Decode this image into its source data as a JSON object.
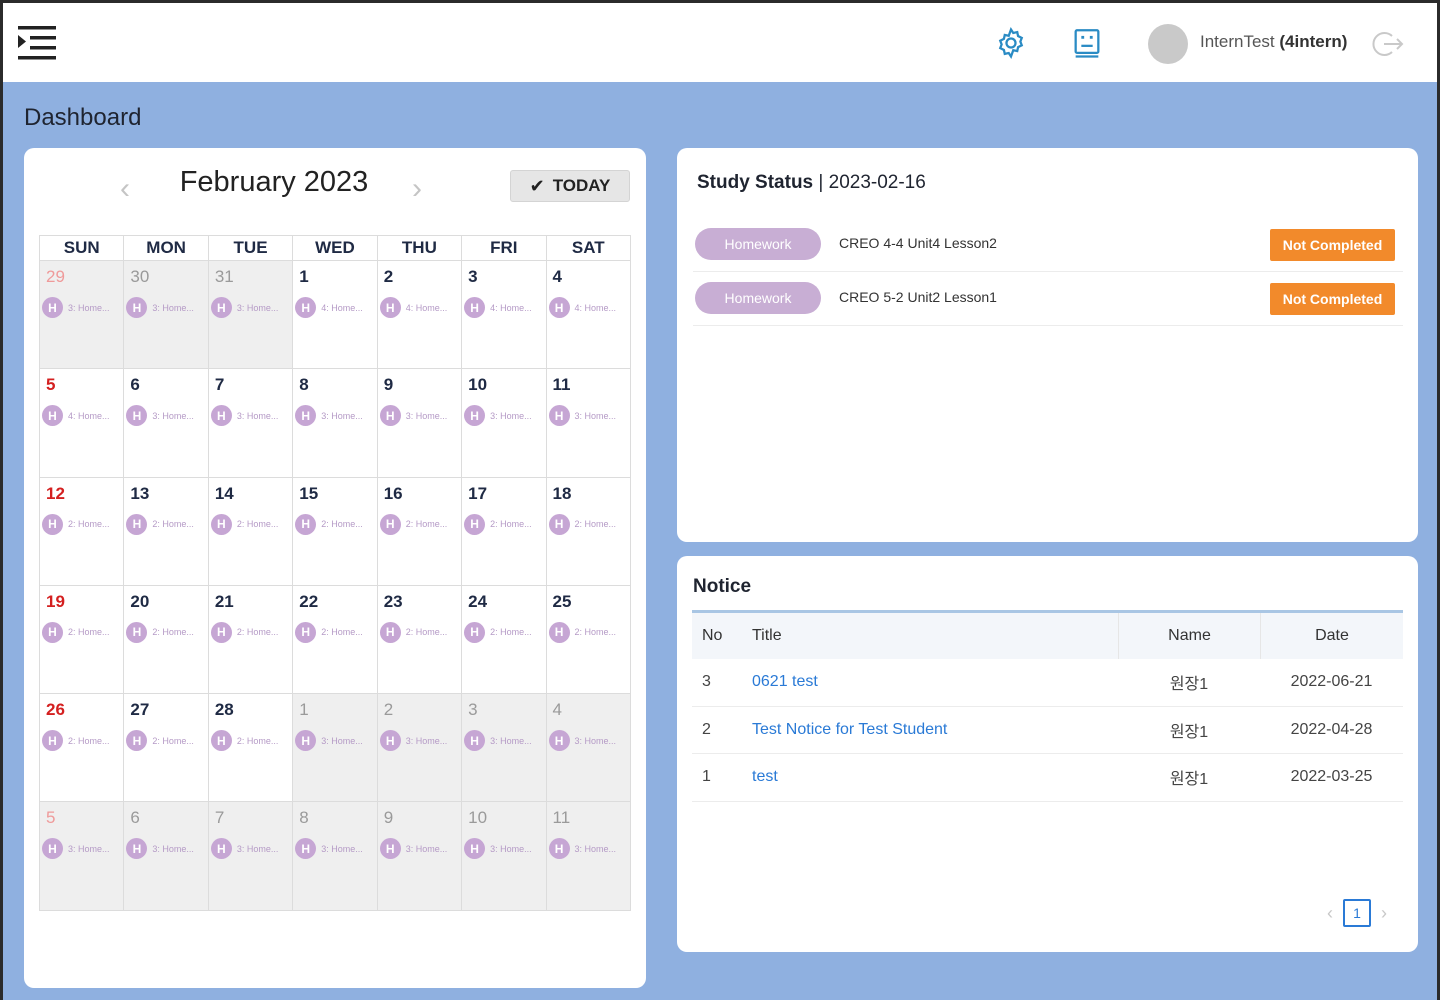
{
  "header": {
    "menu_icon": "indent-menu-icon",
    "settings_icon": "gear-icon",
    "profile_icon": "id-card-icon",
    "user_name": "InternTest",
    "user_id": "(4intern)",
    "logout_icon": "logout-icon"
  },
  "page_title": "Dashboard",
  "calendar": {
    "month_label": "February 2023",
    "today_label": "TODAY",
    "weekdays": [
      "SUN",
      "MON",
      "TUE",
      "WED",
      "THU",
      "FRI",
      "SAT"
    ],
    "weeks": [
      [
        {
          "day": "29",
          "other": true,
          "ev": "3: Home..."
        },
        {
          "day": "30",
          "other": true,
          "ev": "3: Home..."
        },
        {
          "day": "31",
          "other": true,
          "ev": "3: Home..."
        },
        {
          "day": "1",
          "other": false,
          "ev": "4: Home..."
        },
        {
          "day": "2",
          "other": false,
          "ev": "4: Home..."
        },
        {
          "day": "3",
          "other": false,
          "ev": "4: Home..."
        },
        {
          "day": "4",
          "other": false,
          "ev": "4: Home..."
        }
      ],
      [
        {
          "day": "5",
          "other": false,
          "ev": "4: Home..."
        },
        {
          "day": "6",
          "other": false,
          "ev": "3: Home..."
        },
        {
          "day": "7",
          "other": false,
          "ev": "3: Home..."
        },
        {
          "day": "8",
          "other": false,
          "ev": "3: Home..."
        },
        {
          "day": "9",
          "other": false,
          "ev": "3: Home..."
        },
        {
          "day": "10",
          "other": false,
          "ev": "3: Home..."
        },
        {
          "day": "11",
          "other": false,
          "ev": "3: Home..."
        }
      ],
      [
        {
          "day": "12",
          "other": false,
          "ev": "2: Home..."
        },
        {
          "day": "13",
          "other": false,
          "ev": "2: Home..."
        },
        {
          "day": "14",
          "other": false,
          "ev": "2: Home..."
        },
        {
          "day": "15",
          "other": false,
          "ev": "2: Home..."
        },
        {
          "day": "16",
          "other": false,
          "ev": "2: Home..."
        },
        {
          "day": "17",
          "other": false,
          "ev": "2: Home..."
        },
        {
          "day": "18",
          "other": false,
          "ev": "2: Home..."
        }
      ],
      [
        {
          "day": "19",
          "other": false,
          "ev": "2: Home..."
        },
        {
          "day": "20",
          "other": false,
          "ev": "2: Home..."
        },
        {
          "day": "21",
          "other": false,
          "ev": "2: Home..."
        },
        {
          "day": "22",
          "other": false,
          "ev": "2: Home..."
        },
        {
          "day": "23",
          "other": false,
          "ev": "2: Home..."
        },
        {
          "day": "24",
          "other": false,
          "ev": "2: Home..."
        },
        {
          "day": "25",
          "other": false,
          "ev": "2: Home..."
        }
      ],
      [
        {
          "day": "26",
          "other": false,
          "ev": "2: Home..."
        },
        {
          "day": "27",
          "other": false,
          "ev": "2: Home..."
        },
        {
          "day": "28",
          "other": false,
          "ev": "2: Home..."
        },
        {
          "day": "1",
          "other": true,
          "ev": "3: Home..."
        },
        {
          "day": "2",
          "other": true,
          "ev": "3: Home..."
        },
        {
          "day": "3",
          "other": true,
          "ev": "3: Home..."
        },
        {
          "day": "4",
          "other": true,
          "ev": "3: Home..."
        }
      ],
      [
        {
          "day": "5",
          "other": true,
          "ev": "3: Home..."
        },
        {
          "day": "6",
          "other": true,
          "ev": "3: Home..."
        },
        {
          "day": "7",
          "other": true,
          "ev": "3: Home..."
        },
        {
          "day": "8",
          "other": true,
          "ev": "3: Home..."
        },
        {
          "day": "9",
          "other": true,
          "ev": "3: Home..."
        },
        {
          "day": "10",
          "other": true,
          "ev": "3: Home..."
        },
        {
          "day": "11",
          "other": true,
          "ev": "3: Home..."
        }
      ]
    ],
    "event_badge": "H"
  },
  "study_status": {
    "title": "Study Status",
    "date": "2023-02-16",
    "rows": [
      {
        "type": "Homework",
        "name": "CREO 4-4 Unit4 Lesson2",
        "status": "Not Completed"
      },
      {
        "type": "Homework",
        "name": "CREO 5-2 Unit2 Lesson1",
        "status": "Not Completed"
      }
    ]
  },
  "notice": {
    "title": "Notice",
    "columns": {
      "no": "No",
      "title": "Title",
      "name": "Name",
      "date": "Date"
    },
    "rows": [
      {
        "no": "3",
        "title": "0621 test",
        "name": "원장1",
        "date": "2022-06-21"
      },
      {
        "no": "2",
        "title": "Test Notice for Test Student",
        "name": "원장1",
        "date": "2022-04-28"
      },
      {
        "no": "1",
        "title": "test",
        "name": "원장1",
        "date": "2022-03-25"
      }
    ],
    "current_page": "1"
  },
  "colors": {
    "background": "#8fb0e0",
    "accent": "#2a7ad6",
    "homework_pill": "#c8aed4",
    "not_completed": "#f28a2b",
    "sunday": "#d42020"
  }
}
